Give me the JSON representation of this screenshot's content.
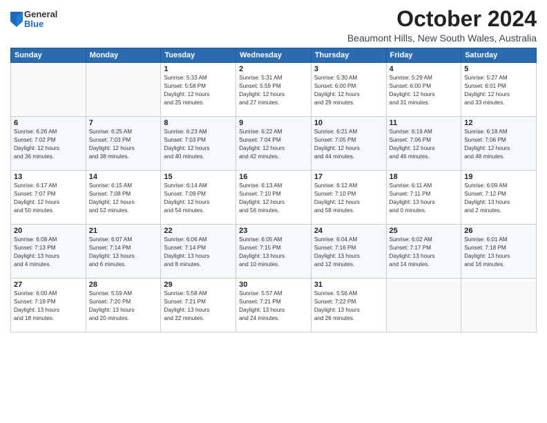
{
  "logo": {
    "general": "General",
    "blue": "Blue"
  },
  "header": {
    "month": "October 2024",
    "location": "Beaumont Hills, New South Wales, Australia"
  },
  "days_of_week": [
    "Sunday",
    "Monday",
    "Tuesday",
    "Wednesday",
    "Thursday",
    "Friday",
    "Saturday"
  ],
  "weeks": [
    [
      {
        "day": "",
        "info": ""
      },
      {
        "day": "",
        "info": ""
      },
      {
        "day": "1",
        "info": "Sunrise: 5:33 AM\nSunset: 5:58 PM\nDaylight: 12 hours\nand 25 minutes."
      },
      {
        "day": "2",
        "info": "Sunrise: 5:31 AM\nSunset: 5:59 PM\nDaylight: 12 hours\nand 27 minutes."
      },
      {
        "day": "3",
        "info": "Sunrise: 5:30 AM\nSunset: 6:00 PM\nDaylight: 12 hours\nand 29 minutes."
      },
      {
        "day": "4",
        "info": "Sunrise: 5:29 AM\nSunset: 6:00 PM\nDaylight: 12 hours\nand 31 minutes."
      },
      {
        "day": "5",
        "info": "Sunrise: 5:27 AM\nSunset: 6:01 PM\nDaylight: 12 hours\nand 33 minutes."
      }
    ],
    [
      {
        "day": "6",
        "info": "Sunrise: 6:26 AM\nSunset: 7:02 PM\nDaylight: 12 hours\nand 36 minutes."
      },
      {
        "day": "7",
        "info": "Sunrise: 6:25 AM\nSunset: 7:03 PM\nDaylight: 12 hours\nand 38 minutes."
      },
      {
        "day": "8",
        "info": "Sunrise: 6:23 AM\nSunset: 7:03 PM\nDaylight: 12 hours\nand 40 minutes."
      },
      {
        "day": "9",
        "info": "Sunrise: 6:22 AM\nSunset: 7:04 PM\nDaylight: 12 hours\nand 42 minutes."
      },
      {
        "day": "10",
        "info": "Sunrise: 6:21 AM\nSunset: 7:05 PM\nDaylight: 12 hours\nand 44 minutes."
      },
      {
        "day": "11",
        "info": "Sunrise: 6:19 AM\nSunset: 7:06 PM\nDaylight: 12 hours\nand 46 minutes."
      },
      {
        "day": "12",
        "info": "Sunrise: 6:18 AM\nSunset: 7:06 PM\nDaylight: 12 hours\nand 48 minutes."
      }
    ],
    [
      {
        "day": "13",
        "info": "Sunrise: 6:17 AM\nSunset: 7:07 PM\nDaylight: 12 hours\nand 50 minutes."
      },
      {
        "day": "14",
        "info": "Sunrise: 6:15 AM\nSunset: 7:08 PM\nDaylight: 12 hours\nand 52 minutes."
      },
      {
        "day": "15",
        "info": "Sunrise: 6:14 AM\nSunset: 7:09 PM\nDaylight: 12 hours\nand 54 minutes."
      },
      {
        "day": "16",
        "info": "Sunrise: 6:13 AM\nSunset: 7:10 PM\nDaylight: 12 hours\nand 56 minutes."
      },
      {
        "day": "17",
        "info": "Sunrise: 6:12 AM\nSunset: 7:10 PM\nDaylight: 12 hours\nand 58 minutes."
      },
      {
        "day": "18",
        "info": "Sunrise: 6:11 AM\nSunset: 7:11 PM\nDaylight: 13 hours\nand 0 minutes."
      },
      {
        "day": "19",
        "info": "Sunrise: 6:09 AM\nSunset: 7:12 PM\nDaylight: 13 hours\nand 2 minutes."
      }
    ],
    [
      {
        "day": "20",
        "info": "Sunrise: 6:08 AM\nSunset: 7:13 PM\nDaylight: 13 hours\nand 4 minutes."
      },
      {
        "day": "21",
        "info": "Sunrise: 6:07 AM\nSunset: 7:14 PM\nDaylight: 13 hours\nand 6 minutes."
      },
      {
        "day": "22",
        "info": "Sunrise: 6:06 AM\nSunset: 7:14 PM\nDaylight: 13 hours\nand 8 minutes."
      },
      {
        "day": "23",
        "info": "Sunrise: 6:05 AM\nSunset: 7:15 PM\nDaylight: 13 hours\nand 10 minutes."
      },
      {
        "day": "24",
        "info": "Sunrise: 6:04 AM\nSunset: 7:16 PM\nDaylight: 13 hours\nand 12 minutes."
      },
      {
        "day": "25",
        "info": "Sunrise: 6:02 AM\nSunset: 7:17 PM\nDaylight: 13 hours\nand 14 minutes."
      },
      {
        "day": "26",
        "info": "Sunrise: 6:01 AM\nSunset: 7:18 PM\nDaylight: 13 hours\nand 16 minutes."
      }
    ],
    [
      {
        "day": "27",
        "info": "Sunrise: 6:00 AM\nSunset: 7:19 PM\nDaylight: 13 hours\nand 18 minutes."
      },
      {
        "day": "28",
        "info": "Sunrise: 5:59 AM\nSunset: 7:20 PM\nDaylight: 13 hours\nand 20 minutes."
      },
      {
        "day": "29",
        "info": "Sunrise: 5:58 AM\nSunset: 7:21 PM\nDaylight: 13 hours\nand 22 minutes."
      },
      {
        "day": "30",
        "info": "Sunrise: 5:57 AM\nSunset: 7:21 PM\nDaylight: 13 hours\nand 24 minutes."
      },
      {
        "day": "31",
        "info": "Sunrise: 5:56 AM\nSunset: 7:22 PM\nDaylight: 13 hours\nand 26 minutes."
      },
      {
        "day": "",
        "info": ""
      },
      {
        "day": "",
        "info": ""
      }
    ]
  ]
}
